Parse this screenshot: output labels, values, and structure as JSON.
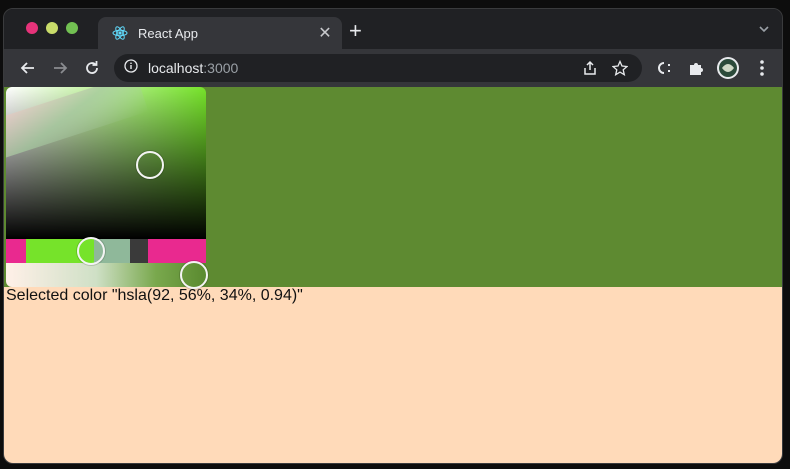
{
  "colors": {
    "traffic_close": "#e6337a",
    "traffic_min": "#c9dc6a",
    "traffic_max": "#72c052",
    "selected": "#5e8a31",
    "page_bg": "#ffdab9"
  },
  "browser": {
    "tab_title": "React App",
    "favicon": "react-icon",
    "url_host": "localhost",
    "url_port": ":3000"
  },
  "picker": {
    "hue": 92,
    "saturation_pct": 56,
    "lightness_pct": 34,
    "alpha": 0.94
  },
  "output": {
    "label": "Selected color \"hsla(92, 56%, 34%, 0.94)\""
  }
}
